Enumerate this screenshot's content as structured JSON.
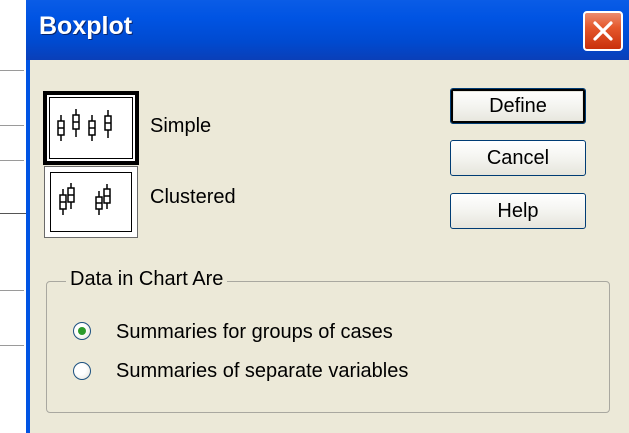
{
  "dialog": {
    "title": "Boxplot"
  },
  "chart_types": [
    {
      "label": "Simple",
      "selected": true,
      "icon": "simple-boxplot-icon"
    },
    {
      "label": "Clustered",
      "selected": false,
      "icon": "clustered-boxplot-icon"
    }
  ],
  "buttons": {
    "define": "Define",
    "cancel": "Cancel",
    "help": "Help"
  },
  "data_group": {
    "legend": "Data in Chart Are",
    "options": [
      {
        "label": "Summaries for groups of cases",
        "checked": true
      },
      {
        "label": "Summaries of separate variables",
        "checked": false
      }
    ]
  },
  "colors": {
    "titlebar": "#0054e3",
    "dialog_bg": "#ece9d8",
    "close": "#e5582c",
    "radio_dot": "#2b9b2b"
  }
}
